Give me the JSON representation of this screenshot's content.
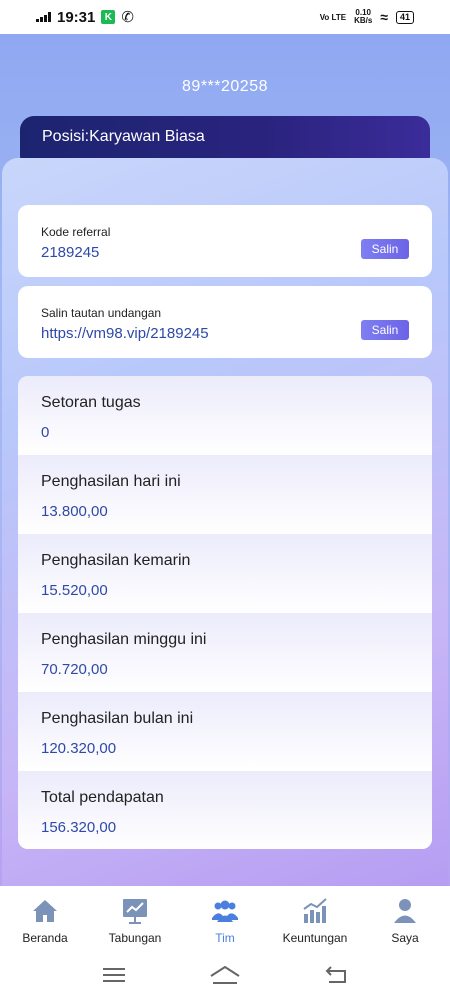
{
  "status_bar": {
    "time": "19:31",
    "network_label": "Vo LTE",
    "speed": "0.10",
    "speed_unit": "KB/s",
    "battery": "41"
  },
  "header": {
    "phone": "89***20258",
    "position": "Posisi:Karyawan Biasa"
  },
  "referral": {
    "label": "Kode referral",
    "value": "2189245",
    "copy_label": "Salin"
  },
  "invite": {
    "label": "Salin tautan undangan",
    "value": "https://vm98.vip/2189245",
    "copy_label": "Salin"
  },
  "stats": [
    {
      "label": "Setoran tugas",
      "value": "0"
    },
    {
      "label": "Penghasilan hari ini",
      "value": "13.800,00"
    },
    {
      "label": "Penghasilan kemarin",
      "value": "15.520,00"
    },
    {
      "label": "Penghasilan minggu ini",
      "value": "70.720,00"
    },
    {
      "label": "Penghasilan bulan ini",
      "value": "120.320,00"
    },
    {
      "label": "Total pendapatan",
      "value": "156.320,00"
    }
  ],
  "nav": [
    {
      "label": "Beranda",
      "icon": "home-icon"
    },
    {
      "label": "Tabungan",
      "icon": "chart-board-icon"
    },
    {
      "label": "Tim",
      "icon": "team-icon",
      "active": true
    },
    {
      "label": "Keuntungan",
      "icon": "bar-chart-icon"
    },
    {
      "label": "Saya",
      "icon": "user-icon"
    }
  ],
  "colors": {
    "accent": "#4a7fe0",
    "value_text": "#2e49a8",
    "position_bar": "#1c2470",
    "button": "#6c63e6"
  }
}
